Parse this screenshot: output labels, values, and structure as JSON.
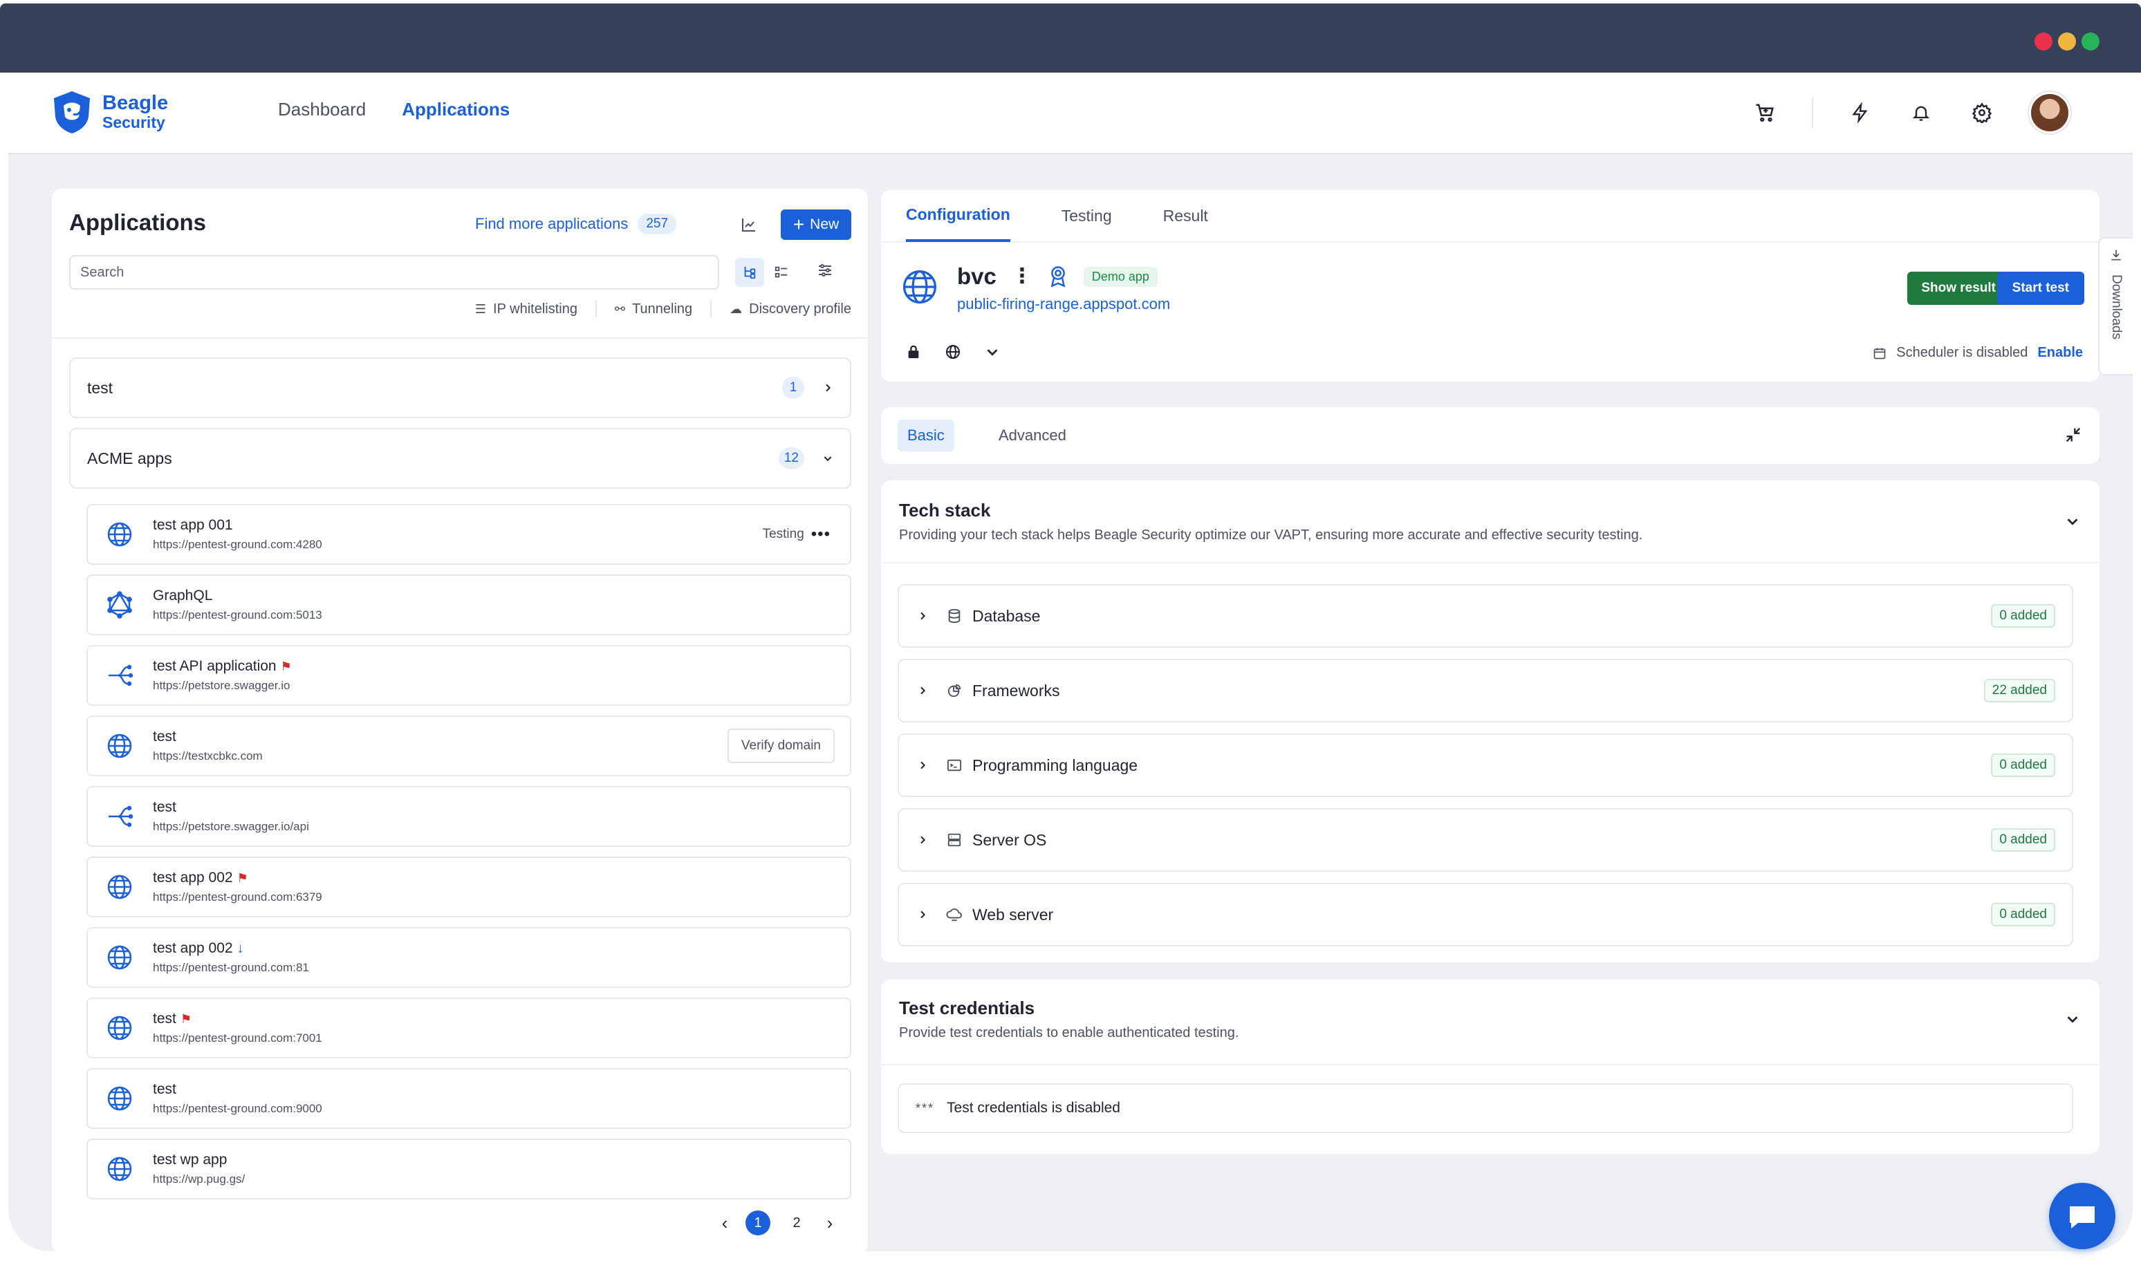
{
  "brand": {
    "name": "Beagle",
    "sub": "Security"
  },
  "nav": {
    "links": [
      "Dashboard",
      "Applications"
    ],
    "active_index": 1
  },
  "colors": {
    "accent": "#1b5fd9",
    "chrome": "#374059",
    "success": "#1f7a3e",
    "flag": "#d62b2b",
    "dot_red": "#e8324a",
    "dot_yellow": "#f2b640",
    "dot_green": "#28b35a"
  },
  "left": {
    "title": "Applications",
    "find_more": "Find more applications",
    "find_more_count": "257",
    "new_label": "New",
    "search_placeholder": "Search",
    "links": [
      "IP whitelisting",
      "Tunneling",
      "Discovery profile"
    ],
    "groups": [
      {
        "name": "test",
        "count": "1"
      },
      {
        "name": "ACME apps",
        "count": "12"
      }
    ],
    "apps": [
      {
        "name": "test app 001",
        "url": "https://pentest-ground.com:4280",
        "icon": "globe-icon",
        "flag": false,
        "arrow": false,
        "status": "Testing",
        "action": ""
      },
      {
        "name": "GraphQL",
        "url": "https://pentest-ground.com:5013",
        "icon": "graphql-icon",
        "flag": false,
        "arrow": false,
        "status": "",
        "action": ""
      },
      {
        "name": "test API application",
        "url": "https://petstore.swagger.io",
        "icon": "api-icon",
        "flag": true,
        "arrow": false,
        "status": "",
        "action": ""
      },
      {
        "name": "test",
        "url": "https://testxcbkc.com",
        "icon": "globe-icon",
        "flag": false,
        "arrow": false,
        "status": "",
        "action": "Verify domain"
      },
      {
        "name": "test",
        "url": "https://petstore.swagger.io/api",
        "icon": "api-icon",
        "flag": false,
        "arrow": false,
        "status": "",
        "action": ""
      },
      {
        "name": "test app 002",
        "url": "https://pentest-ground.com:6379",
        "icon": "globe-icon",
        "flag": true,
        "arrow": false,
        "status": "",
        "action": ""
      },
      {
        "name": "test app 002",
        "url": "https://pentest-ground.com:81",
        "icon": "globe-icon",
        "flag": false,
        "arrow": true,
        "status": "",
        "action": ""
      },
      {
        "name": "test",
        "url": "https://pentest-ground.com:7001",
        "icon": "globe-icon",
        "flag": true,
        "arrow": false,
        "status": "",
        "action": ""
      },
      {
        "name": "test",
        "url": "https://pentest-ground.com:9000",
        "icon": "globe-icon",
        "flag": false,
        "arrow": false,
        "status": "",
        "action": ""
      },
      {
        "name": "test wp app",
        "url": "https://wp.pug.gs/",
        "icon": "globe-icon",
        "flag": false,
        "arrow": false,
        "status": "",
        "action": ""
      }
    ],
    "pager": {
      "pages": [
        "1",
        "2"
      ],
      "current": "1"
    }
  },
  "right": {
    "tabs": [
      "Configuration",
      "Testing",
      "Result"
    ],
    "active_tab": 0,
    "app_name": "bvc",
    "demo_badge": "Demo app",
    "app_url": "public-firing-range.appspot.com",
    "show_result": "Show result",
    "start_test": "Start test",
    "scheduler_text": "Scheduler is disabled",
    "scheduler_action": "Enable",
    "sub_tabs": [
      "Basic",
      "Advanced"
    ],
    "tech_stack": {
      "title": "Tech stack",
      "subtitle": "Providing your tech stack helps Beagle Security optimize our VAPT, ensuring more accurate and effective security testing.",
      "rows": [
        {
          "label": "Database",
          "added": "0 added",
          "icon": "database-icon"
        },
        {
          "label": "Frameworks",
          "added": "22 added",
          "icon": "framework-icon"
        },
        {
          "label": "Programming language",
          "added": "0 added",
          "icon": "code-icon"
        },
        {
          "label": "Server OS",
          "added": "0 added",
          "icon": "server-icon"
        },
        {
          "label": "Web server",
          "added": "0 added",
          "icon": "cloud-icon"
        }
      ]
    },
    "credentials": {
      "title": "Test credentials",
      "subtitle": "Provide test credentials to enable authenticated testing.",
      "status": "Test credentials is disabled"
    }
  },
  "downloads_label": "Downloads"
}
